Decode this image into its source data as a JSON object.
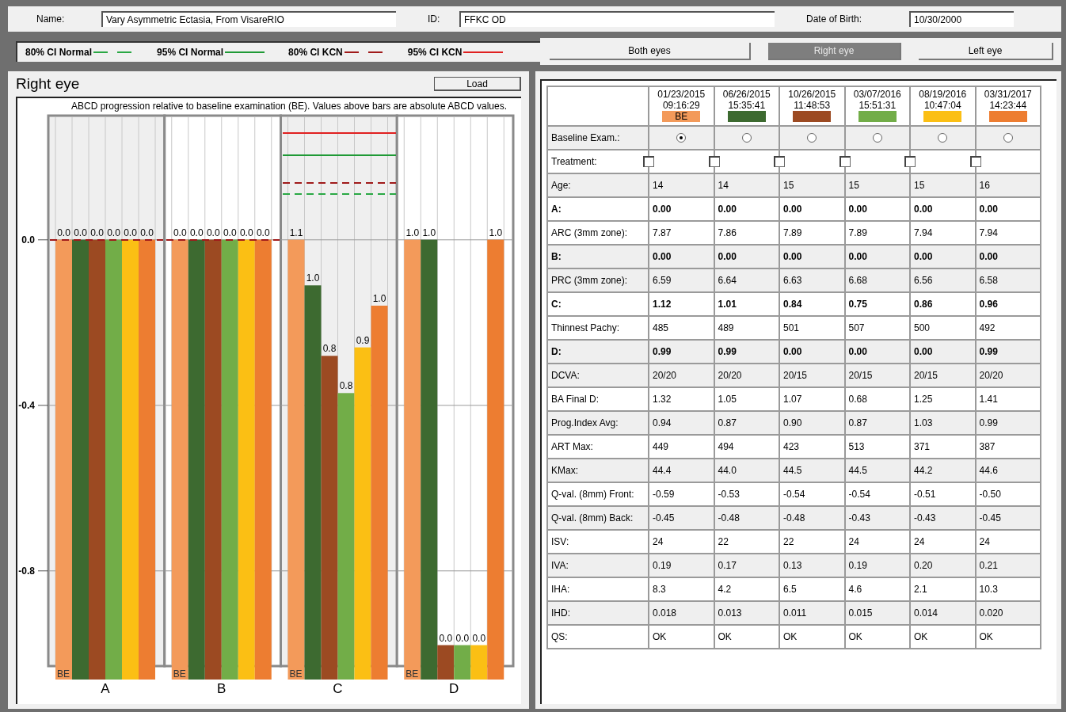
{
  "patient": {
    "fields": [
      {
        "label": "Name:",
        "value": "Vary Asymmetric Ectasia, From VisareRIO"
      },
      {
        "label": "ID:",
        "value": "FFKC OD"
      },
      {
        "label": "Date of Birth:",
        "value": "10/30/2000"
      }
    ]
  },
  "legend": [
    {
      "label": "80% CI Normal",
      "dashed": true,
      "color": "#2aa844"
    },
    {
      "label": "95% CI Normal",
      "dashed": false,
      "color": "#1f9a36"
    },
    {
      "label": "80% CI KCN",
      "dashed": true,
      "color": "#a01a1a"
    },
    {
      "label": "95% CI KCN",
      "dashed": false,
      "color": "#e02020"
    }
  ],
  "eye_tabs": [
    {
      "label": "Both eyes",
      "selected": false
    },
    {
      "label": "Right eye",
      "selected": true
    },
    {
      "label": "Left eye",
      "selected": false
    }
  ],
  "left_panel": {
    "title": "Right eye",
    "load_button": "Load",
    "caption": "ABCD progression relative to baseline examination (BE). Values above bars are absolute ABCD values.",
    "y_ticks": [
      "0.0",
      "-0.4",
      "-0.8"
    ],
    "groups": [
      {
        "label": "A",
        "shaded": true,
        "ci_lines": [
          {
            "color": "#a01a1a",
            "level": 0.78
          }
        ],
        "bars": [
          {
            "color": "#f39a5a",
            "level": 0.78,
            "label": "0.0",
            "badge": "BE"
          },
          {
            "color": "#3d6a30",
            "level": 0.78,
            "label": "0.0"
          },
          {
            "color": "#9c4a22",
            "level": 0.78,
            "label": "0.0"
          },
          {
            "color": "#72ad48",
            "level": 0.78,
            "label": "0.0"
          },
          {
            "color": "#fbbf14",
            "level": 0.78,
            "label": "0.0"
          },
          {
            "color": "#ed7d31",
            "level": 0.78,
            "label": "0.0"
          }
        ]
      },
      {
        "label": "B",
        "shaded": false,
        "ci_lines": [
          {
            "color": "#a01a1a",
            "level": 0.78
          }
        ],
        "bars": [
          {
            "color": "#f39a5a",
            "level": 0.78,
            "label": "0.0",
            "badge": "BE"
          },
          {
            "color": "#3d6a30",
            "level": 0.78,
            "label": "0.0"
          },
          {
            "color": "#9c4a22",
            "level": 0.78,
            "label": "0.0"
          },
          {
            "color": "#72ad48",
            "level": 0.78,
            "label": "0.0"
          },
          {
            "color": "#fbbf14",
            "level": 0.78,
            "label": "0.0"
          },
          {
            "color": "#ed7d31",
            "level": 0.78,
            "label": "0.0"
          }
        ]
      },
      {
        "label": "C",
        "shaded": true,
        "ci_lines": [
          {
            "color": "#e02020",
            "level": 0.969
          },
          {
            "color": "#1f9a36",
            "level": 0.93
          },
          {
            "color": "#a01a1a",
            "level": 0.881
          },
          {
            "color": "#2aa844",
            "level": 0.861
          }
        ],
        "bars": [
          {
            "color": "#f39a5a",
            "level": 0.78,
            "label": "1.1",
            "badge": "BE"
          },
          {
            "color": "#3d6a30",
            "level": 0.699,
            "label": "1.0"
          },
          {
            "color": "#9c4a22",
            "level": 0.574,
            "label": "0.8"
          },
          {
            "color": "#72ad48",
            "level": 0.508,
            "label": "0.8"
          },
          {
            "color": "#fbbf14",
            "level": 0.589,
            "label": "0.9"
          },
          {
            "color": "#ed7d31",
            "level": 0.663,
            "label": "1.0"
          }
        ]
      },
      {
        "label": "D",
        "shaded": false,
        "bars": [
          {
            "color": "#f39a5a",
            "level": 0.78,
            "label": "1.0",
            "badge": "BE"
          },
          {
            "color": "#3d6a30",
            "level": 0.78,
            "label": "1.0"
          },
          {
            "color": "#9c4a22",
            "level": 0.061,
            "label": "0.0"
          },
          {
            "color": "#72ad48",
            "level": 0.061,
            "label": "0.0"
          },
          {
            "color": "#fbbf14",
            "level": 0.061,
            "label": "0.0"
          },
          {
            "color": "#ed7d31",
            "level": 0.78,
            "label": "1.0"
          }
        ]
      }
    ]
  },
  "table": {
    "columns": [
      {
        "date": "01/23/2015",
        "time": "09:16:29",
        "color": "#f39a5a",
        "badge": "BE"
      },
      {
        "date": "06/26/2015",
        "time": "15:35:41",
        "color": "#3d6a30"
      },
      {
        "date": "10/26/2015",
        "time": "11:48:53",
        "color": "#9c4a22"
      },
      {
        "date": "03/07/2016",
        "time": "15:51:31",
        "color": "#72ad48"
      },
      {
        "date": "08/19/2016",
        "time": "10:47:04",
        "color": "#fbbf14"
      },
      {
        "date": "03/31/2017",
        "time": "14:23:44",
        "color": "#ed7d31"
      }
    ],
    "rows": [
      {
        "label": "Baseline Exam.:",
        "kind": "radio",
        "bold": false,
        "shaded": true,
        "cells": [
          {
            "selected": true
          },
          {
            "selected": false
          },
          {
            "selected": false
          },
          {
            "selected": false
          },
          {
            "selected": false
          },
          {
            "selected": false
          }
        ]
      },
      {
        "label": "Treatment:",
        "kind": "checkbox",
        "bold": false,
        "shaded": false,
        "cells": [
          {
            "checked": false
          },
          {
            "checked": false
          },
          {
            "checked": false
          },
          {
            "checked": false
          },
          {
            "checked": false
          },
          {
            "checked": false
          }
        ]
      },
      {
        "label": "Age:",
        "kind": "text",
        "bold": false,
        "shaded": true,
        "cells": [
          "14",
          "14",
          "15",
          "15",
          "15",
          "16"
        ]
      },
      {
        "label": "A:",
        "kind": "text",
        "bold": true,
        "shaded": false,
        "cells": [
          "0.00",
          "0.00",
          "0.00",
          "0.00",
          "0.00",
          "0.00"
        ]
      },
      {
        "label": "ARC (3mm zone):",
        "kind": "text",
        "bold": false,
        "shaded": false,
        "cells": [
          "7.87",
          "7.86",
          "7.89",
          "7.89",
          "7.94",
          "7.94"
        ]
      },
      {
        "label": "B:",
        "kind": "text",
        "bold": true,
        "shaded": true,
        "cells": [
          "0.00",
          "0.00",
          "0.00",
          "0.00",
          "0.00",
          "0.00"
        ]
      },
      {
        "label": "PRC (3mm zone):",
        "kind": "text",
        "bold": false,
        "shaded": true,
        "cells": [
          "6.59",
          "6.64",
          "6.63",
          "6.68",
          "6.56",
          "6.58"
        ]
      },
      {
        "label": "C:",
        "kind": "text",
        "bold": true,
        "shaded": false,
        "cells": [
          "1.12",
          "1.01",
          "0.84",
          "0.75",
          "0.86",
          "0.96"
        ]
      },
      {
        "label": "Thinnest Pachy:",
        "kind": "text",
        "bold": false,
        "shaded": false,
        "cells": [
          "485",
          "489",
          "501",
          "507",
          "500",
          "492"
        ]
      },
      {
        "label": "D:",
        "kind": "text",
        "bold": true,
        "shaded": true,
        "cells": [
          "0.99",
          "0.99",
          "0.00",
          "0.00",
          "0.00",
          "0.99"
        ]
      },
      {
        "label": "DCVA:",
        "kind": "text",
        "bold": false,
        "shaded": true,
        "cells": [
          "20/20",
          "20/20",
          "20/15",
          "20/15",
          "20/15",
          "20/20"
        ]
      },
      {
        "label": "BA Final D:",
        "kind": "text",
        "bold": false,
        "shaded": false,
        "cells": [
          "1.32",
          "1.05",
          "1.07",
          "0.68",
          "1.25",
          "1.41"
        ]
      },
      {
        "label": "Prog.Index Avg:",
        "kind": "text",
        "bold": false,
        "shaded": true,
        "cells": [
          "0.94",
          "0.87",
          "0.90",
          "0.87",
          "1.03",
          "0.99"
        ]
      },
      {
        "label": "ART Max:",
        "kind": "text",
        "bold": false,
        "shaded": false,
        "cells": [
          "449",
          "494",
          "423",
          "513",
          "371",
          "387"
        ]
      },
      {
        "label": "KMax:",
        "kind": "text",
        "bold": false,
        "shaded": true,
        "cells": [
          "44.4",
          "44.0",
          "44.5",
          "44.5",
          "44.2",
          "44.6"
        ]
      },
      {
        "label": "Q-val. (8mm) Front:",
        "kind": "text",
        "bold": false,
        "shaded": false,
        "cells": [
          "-0.59",
          "-0.53",
          "-0.54",
          "-0.54",
          "-0.51",
          "-0.50"
        ]
      },
      {
        "label": "Q-val. (8mm) Back:",
        "kind": "text",
        "bold": false,
        "shaded": true,
        "cells": [
          "-0.45",
          "-0.48",
          "-0.48",
          "-0.43",
          "-0.43",
          "-0.45"
        ]
      },
      {
        "label": "ISV:",
        "kind": "text",
        "bold": false,
        "shaded": false,
        "cells": [
          "24",
          "22",
          "22",
          "24",
          "24",
          "24"
        ]
      },
      {
        "label": "IVA:",
        "kind": "text",
        "bold": false,
        "shaded": true,
        "cells": [
          "0.19",
          "0.17",
          "0.13",
          "0.19",
          "0.20",
          "0.21"
        ]
      },
      {
        "label": "IHA:",
        "kind": "text",
        "bold": false,
        "shaded": false,
        "cells": [
          "8.3",
          "4.2",
          "6.5",
          "4.6",
          "2.1",
          "10.3"
        ]
      },
      {
        "label": "IHD:",
        "kind": "text",
        "bold": false,
        "shaded": true,
        "cells": [
          "0.018",
          "0.013",
          "0.011",
          "0.015",
          "0.014",
          "0.020"
        ]
      },
      {
        "label": "QS:",
        "kind": "text",
        "bold": false,
        "shaded": false,
        "cells": [
          "OK",
          "OK",
          "OK",
          "OK",
          "OK",
          "OK"
        ]
      }
    ]
  }
}
